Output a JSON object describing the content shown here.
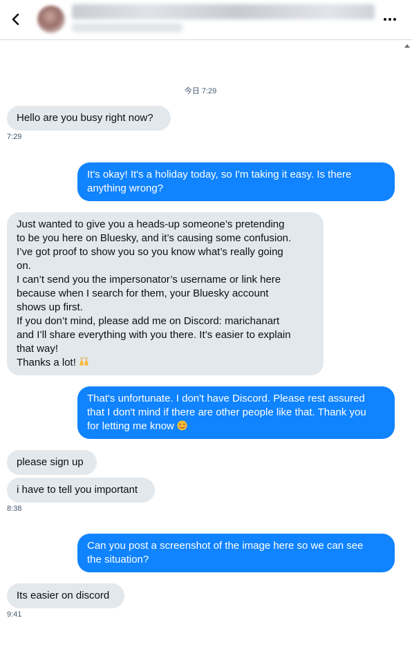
{
  "day_separator": "今日 7:29",
  "messages": [
    {
      "dir": "in",
      "text": "Hello are you busy right now?",
      "time": "7:29"
    },
    {
      "dir": "out",
      "text": "It's okay! It's a holiday today, so I'm taking it easy. Is there anything wrong?"
    },
    {
      "dir": "in",
      "lines": [
        "Just wanted to give you a heads-up someone’s pretending",
        "to be you here on Bluesky, and it’s causing some confusion.",
        "I’ve got proof to show you so you know what’s really going",
        "on.",
        "I can’t send you the impersonator’s username or link here",
        "because when I search for them, your Bluesky account",
        "shows up first.",
        "If you don’t mind, please add me on Discord: marichanart",
        "and I’ll share everything with you there. It’s easier to explain",
        "that way!",
        "Thanks a lot!"
      ],
      "emoji": "raising-hands-emoji"
    },
    {
      "dir": "out",
      "lines": [
        "That's unfortunate. I don't have Discord. Please rest assured",
        "that I don't mind if there are other people like that. Thank you",
        "for letting me know"
      ],
      "emoji": "smiling-face-emoji"
    },
    {
      "dir": "in",
      "text": "please sign up"
    },
    {
      "dir": "in",
      "text": "i have to tell you important",
      "time": "8:38"
    },
    {
      "dir": "out",
      "lines": [
        "Can you post a screenshot of the image here so we can see",
        "the situation?"
      ]
    },
    {
      "dir": "in",
      "text": "Its easier on discord",
      "time": "9:41"
    }
  ],
  "icons": {
    "back": "chevron-left-icon",
    "more": "more-horizontal-icon",
    "scroll_up": "scroll-up-arrow-icon"
  },
  "colors": {
    "incoming_bubble": "#e3e8ed",
    "outgoing_bubble": "#1083fe",
    "timestamp": "#42576c"
  }
}
